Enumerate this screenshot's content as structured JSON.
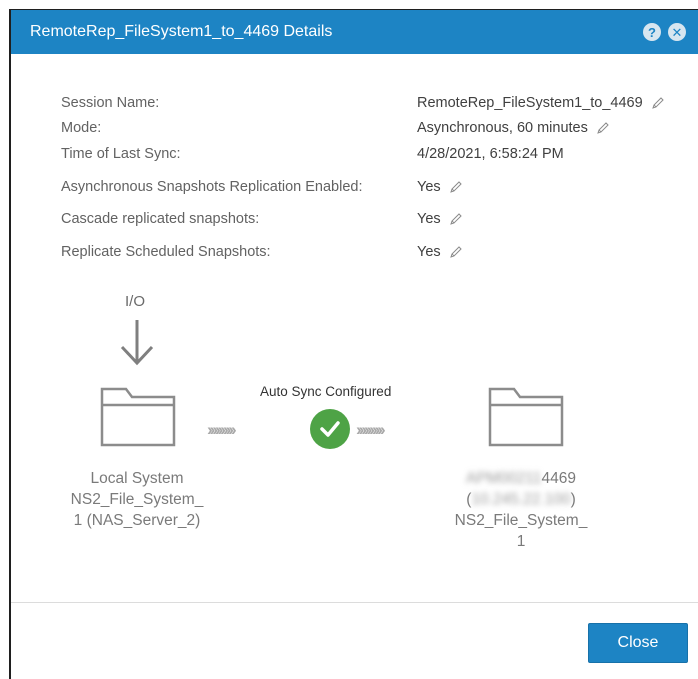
{
  "dialog": {
    "title": "RemoteRep_FileSystem1_to_4469 Details",
    "help_icon": "help-icon",
    "close_icon": "close-icon"
  },
  "properties": [
    {
      "label": "Session Name:",
      "value": "RemoteRep_FileSystem1_to_4469",
      "editable": true
    },
    {
      "label": "Mode:",
      "value": "Asynchronous, 60 minutes",
      "editable": true
    },
    {
      "label": "Time of Last Sync:",
      "value": "4/28/2021, 6:58:24 PM",
      "editable": false
    },
    {
      "label": "Asynchronous Snapshots Replication Enabled:",
      "value": "Yes",
      "editable": true
    },
    {
      "label": "Cascade replicated snapshots:",
      "value": "Yes",
      "editable": true
    },
    {
      "label": "Replicate Scheduled Snapshots:",
      "value": "Yes",
      "editable": true
    }
  ],
  "diagram": {
    "io_label": "I/O",
    "sync_status": "Auto Sync Configured",
    "local": {
      "line1": "Local System",
      "line2": "NS2_File_System_",
      "line3": "1 (NAS_Server_2)"
    },
    "remote": {
      "name_suffix": "4469",
      "name_redacted": "APM00211",
      "ip_open": "(",
      "ip_redacted": "10.245.22.100",
      "ip_close": ")",
      "line3": "NS2_File_System_",
      "line4": "1"
    }
  },
  "footer": {
    "close_label": "Close"
  },
  "colors": {
    "accent": "#1d84c4",
    "success": "#4ea346"
  }
}
